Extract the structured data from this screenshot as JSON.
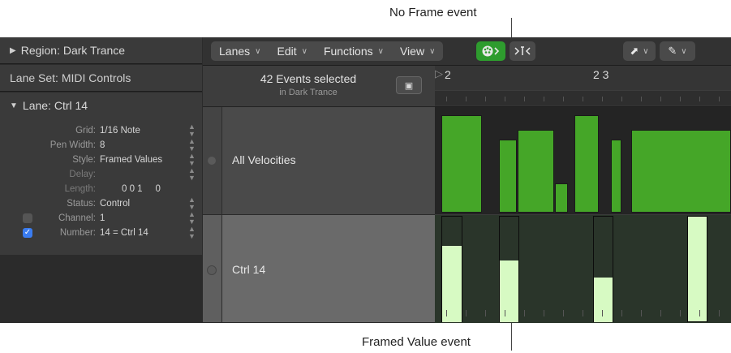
{
  "callouts": {
    "top": "No Frame event",
    "bottom": "Framed Value event"
  },
  "inspector": {
    "region": "Region: Dark Trance",
    "lane_set": "Lane Set: MIDI Controls",
    "lane": "Lane:  Ctrl 14",
    "params": [
      {
        "key": "Grid:",
        "value": "1/16 Note"
      },
      {
        "key": "Pen Width:",
        "value": "8"
      },
      {
        "key": "Style:",
        "value": "Framed Values"
      },
      {
        "key": "Delay:",
        "value": ""
      },
      {
        "key": "Length:",
        "value": "0 0 1     0"
      },
      {
        "key": "Status:",
        "value": "Control"
      },
      {
        "key": "Channel:",
        "value": "1",
        "checked": false
      },
      {
        "key": "Number:",
        "value": "14 = Ctrl 14",
        "checked": true
      }
    ]
  },
  "toolbar": {
    "menus": [
      "Lanes",
      "Edit",
      "Functions",
      "View"
    ],
    "midi_in_icon": "midi-in-icon",
    "catch_icon": "catch-icon",
    "pointer_icon": "pointer-tool-icon",
    "pencil_icon": "pencil-tool-icon"
  },
  "lane_header": {
    "selected": "42 Events selected",
    "sub": "in Dark Trance"
  },
  "lanes": [
    {
      "name": "All Velocities"
    },
    {
      "name": "Ctrl 14"
    }
  ],
  "ruler": {
    "bar_2": "2",
    "beat_23": "2 3"
  },
  "colors": {
    "event_green": "#45a628",
    "framed_fill": "#d7fac3",
    "toolbar_green": "#2e9c2e",
    "checkbox_blue": "#3a7cf0"
  },
  "events": {
    "velocity_levels": [
      1.0,
      0.75,
      0.85,
      0.3,
      1.0,
      0.75,
      0.85
    ],
    "ctrl14_levels": [
      0.72,
      0.58,
      0.42,
      1.0
    ]
  }
}
